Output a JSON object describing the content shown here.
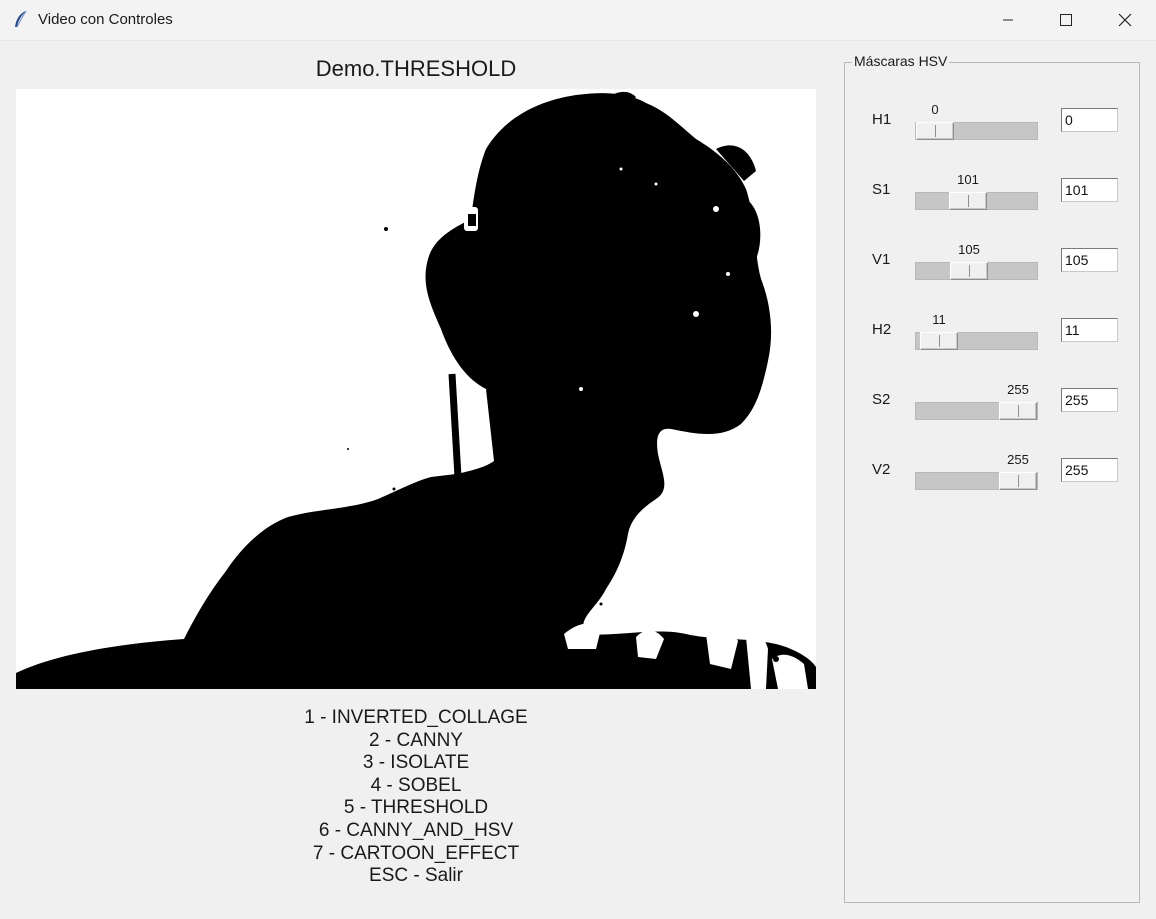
{
  "window": {
    "title": "Video con Controles",
    "icon": "feather-icon",
    "controls": [
      "minimize-icon",
      "maximize-icon",
      "close-icon"
    ]
  },
  "main": {
    "title": "Demo.THRESHOLD",
    "video": "threshold silhouette: black figure with headphones on white background",
    "menu": [
      "1 - INVERTED_COLLAGE",
      "2 - CANNY",
      "3 - ISOLATE",
      "4 - SOBEL",
      "5 - THRESHOLD",
      "6 - CANNY_AND_HSV",
      "7 - CARTOON_EFFECT",
      "ESC - Salir"
    ]
  },
  "hsv": {
    "title": "Máscaras HSV",
    "range": [
      0,
      255
    ],
    "controls": [
      {
        "label": "H1",
        "value": 0,
        "display": "0",
        "entry": "0"
      },
      {
        "label": "S1",
        "value": 101,
        "display": "101",
        "entry": "101"
      },
      {
        "label": "V1",
        "value": 105,
        "display": "105",
        "entry": "105"
      },
      {
        "label": "H2",
        "value": 11,
        "display": "11",
        "entry": "11"
      },
      {
        "label": "S2",
        "value": 255,
        "display": "255",
        "entry": "255"
      },
      {
        "label": "V2",
        "value": 255,
        "display": "255",
        "entry": "255"
      }
    ]
  },
  "colors": {
    "window_bg": "#f0f0f0",
    "silhouette": "#000000",
    "video_bg": "#ffffff"
  }
}
